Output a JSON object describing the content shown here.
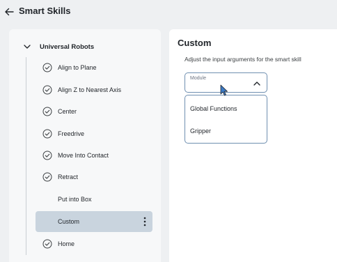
{
  "header": {
    "title": "Smart Skills",
    "back_icon": "arrow-left-icon"
  },
  "sidebar": {
    "group": {
      "label": "Universal Robots",
      "expanded": true
    },
    "items": [
      {
        "label": "Align to Plane",
        "icon": "check-circle-icon"
      },
      {
        "label": "Align Z to Nearest Axis",
        "icon": "check-circle-icon"
      },
      {
        "label": "Center",
        "icon": "check-circle-icon"
      },
      {
        "label": "Freedrive",
        "icon": "check-circle-icon"
      },
      {
        "label": "Move Into Contact",
        "icon": "check-circle-icon"
      },
      {
        "label": "Retract",
        "icon": "check-circle-icon"
      },
      {
        "label": "Put into Box",
        "icon": ""
      },
      {
        "label": "Custom",
        "icon": "",
        "selected": true
      },
      {
        "label": "Home",
        "icon": "check-circle-icon"
      }
    ]
  },
  "main": {
    "title": "Custom",
    "description": "Adjust the input arguments for the smart skill",
    "module_select": {
      "label": "Module",
      "value": "",
      "open": true,
      "options": [
        "Global Functions",
        "Gripper"
      ]
    }
  },
  "colors": {
    "selected_bg": "#c9d4de",
    "border_accent": "#6f8fb0"
  }
}
